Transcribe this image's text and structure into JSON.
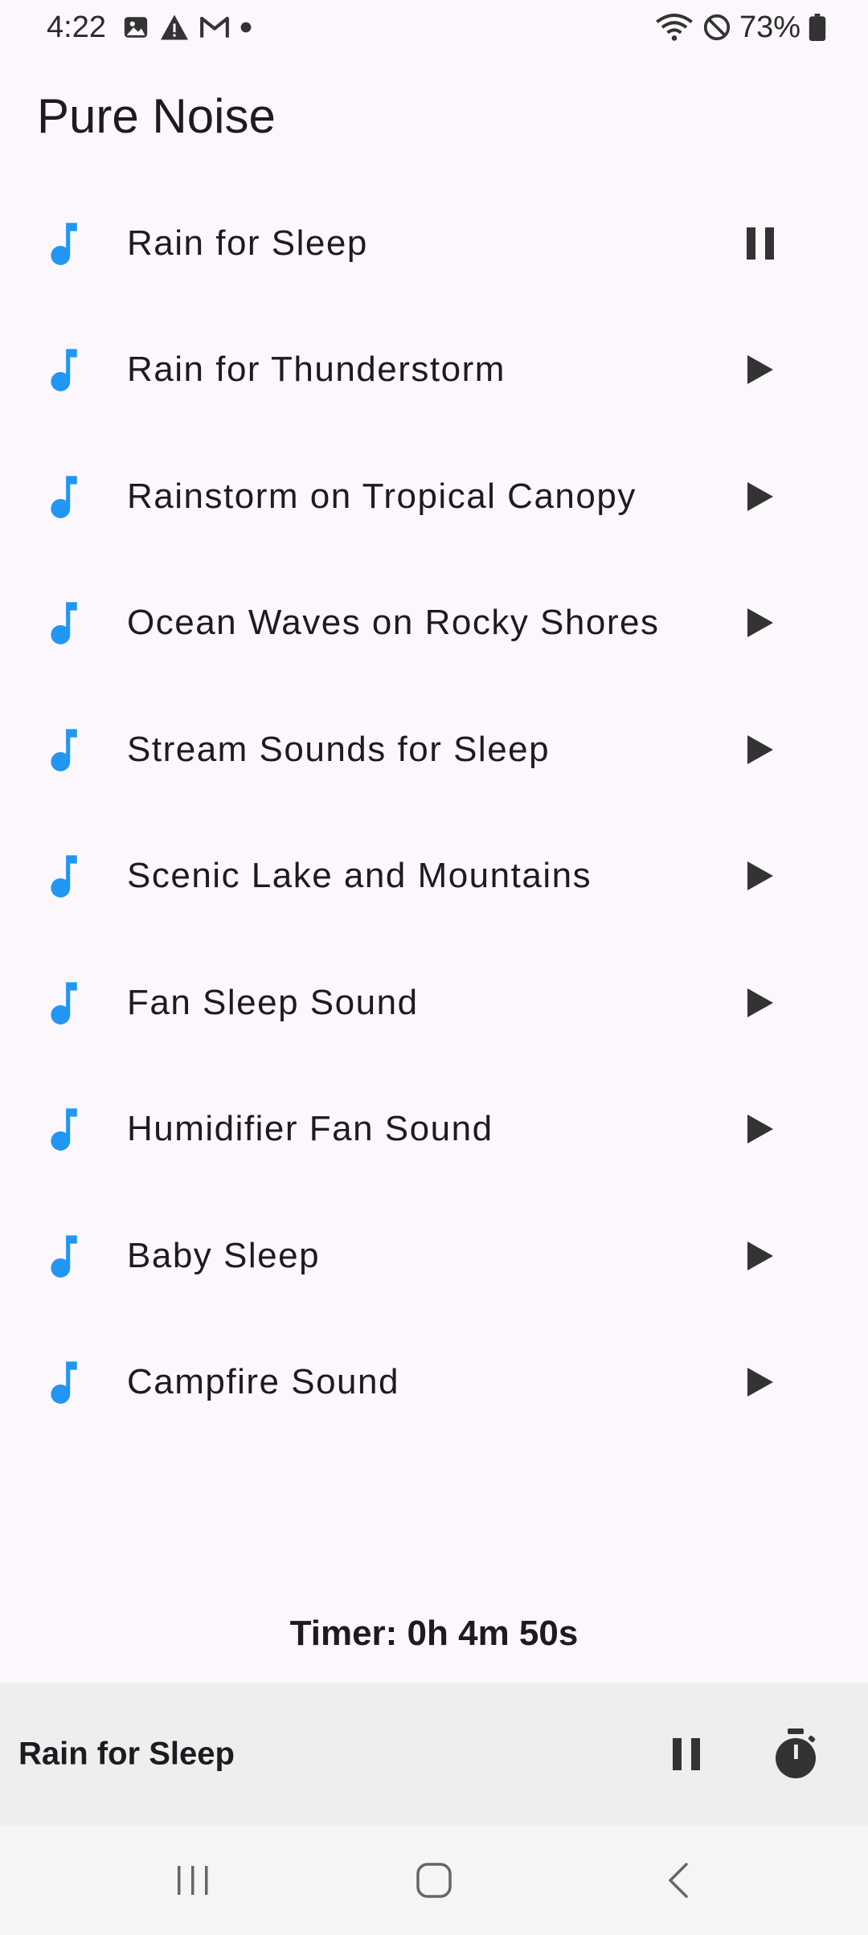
{
  "status_bar": {
    "time": "4:22",
    "battery_percent": "73%",
    "left_icons": [
      "image-icon",
      "warning-icon",
      "gmail-icon",
      "dot-icon"
    ],
    "right_icons": [
      "wifi-icon",
      "do-not-disturb-icon",
      "battery-icon"
    ]
  },
  "app": {
    "title": "Pure Noise",
    "accent_color": "#2196F3"
  },
  "tracks": [
    {
      "label": "Rain for Sleep",
      "state": "playing",
      "action_icon": "pause-icon"
    },
    {
      "label": "Rain for Thunderstorm",
      "state": "stopped",
      "action_icon": "play-icon"
    },
    {
      "label": "Rainstorm on Tropical Canopy",
      "state": "stopped",
      "action_icon": "play-icon"
    },
    {
      "label": "Ocean Waves on Rocky Shores",
      "state": "stopped",
      "action_icon": "play-icon"
    },
    {
      "label": "Stream Sounds for Sleep",
      "state": "stopped",
      "action_icon": "play-icon"
    },
    {
      "label": "Scenic Lake and Mountains",
      "state": "stopped",
      "action_icon": "play-icon"
    },
    {
      "label": "Fan Sleep Sound",
      "state": "stopped",
      "action_icon": "play-icon"
    },
    {
      "label": "Humidifier Fan Sound",
      "state": "stopped",
      "action_icon": "play-icon"
    },
    {
      "label": "Baby Sleep",
      "state": "stopped",
      "action_icon": "play-icon"
    },
    {
      "label": "Campfire Sound",
      "state": "stopped",
      "action_icon": "play-icon"
    }
  ],
  "timer": {
    "text": "Timer: 0h 4m 50s"
  },
  "now_playing": {
    "title": "Rain for Sleep",
    "pause_icon": "pause-icon",
    "timer_icon": "stopwatch-icon"
  },
  "nav_bar": {
    "buttons": [
      "recent-apps-icon",
      "home-icon",
      "back-icon"
    ]
  }
}
